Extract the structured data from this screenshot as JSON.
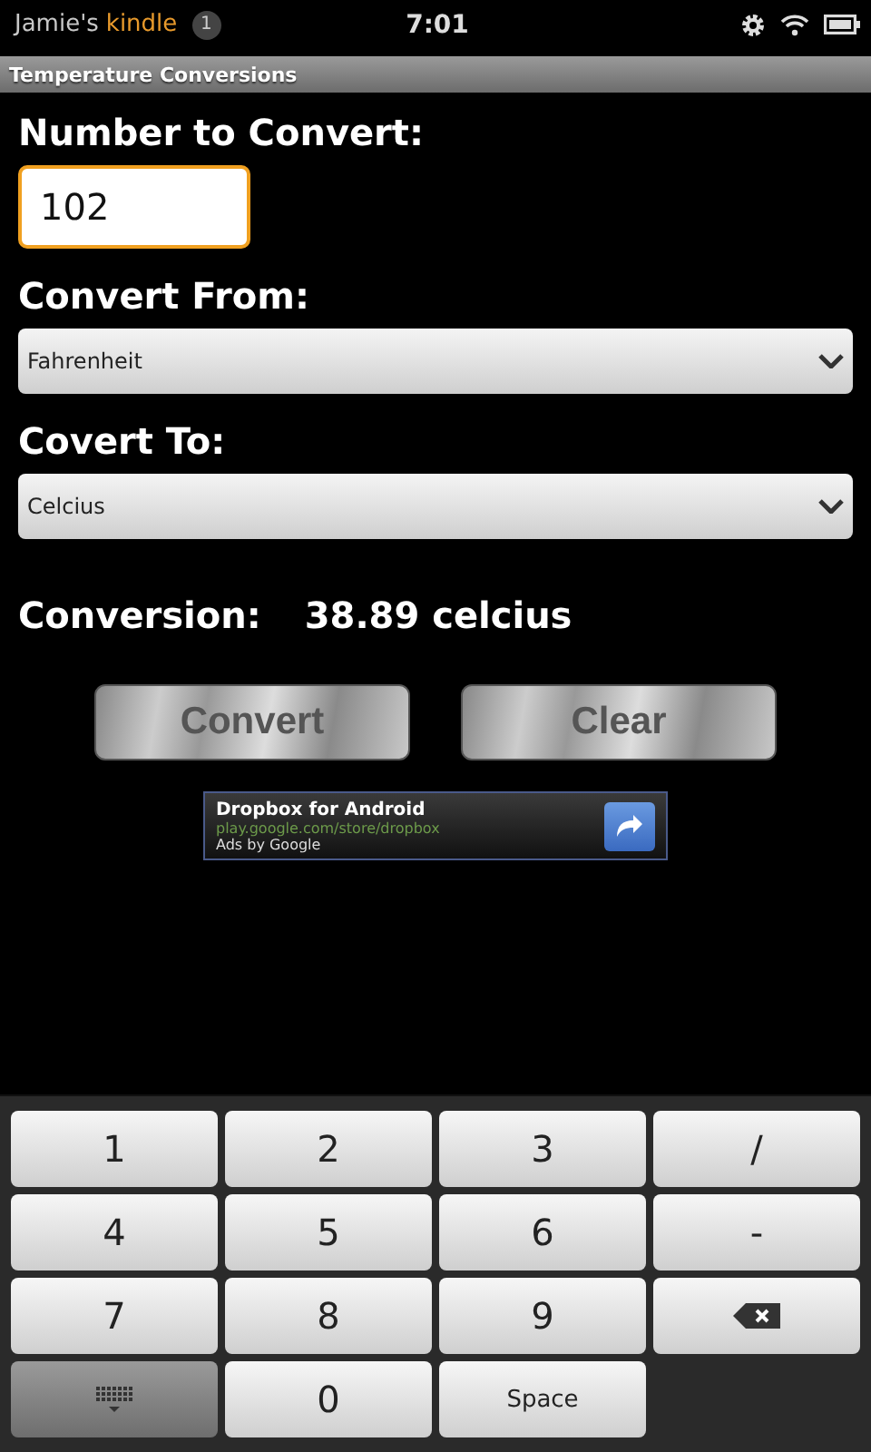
{
  "status_bar": {
    "owner": "Jamie's",
    "brand": "kindle",
    "notification_count": "1",
    "time": "7:01"
  },
  "title_bar": {
    "title": "Temperature Conversions"
  },
  "form": {
    "number_label": "Number to Convert:",
    "number_value": "102",
    "from_label": "Convert From:",
    "from_value": "Fahrenheit",
    "to_label": "Covert To:",
    "to_value": "Celcius",
    "conversion_label": "Conversion:",
    "conversion_value": "38.89 celcius"
  },
  "buttons": [
    "Convert",
    "Clear"
  ],
  "ad": {
    "title": "Dropbox for Android",
    "url": "play.google.com/store/dropbox",
    "attribution": "Ads by Google"
  },
  "keyboard": [
    {
      "kind": "text",
      "label": "1"
    },
    {
      "kind": "text",
      "label": "2"
    },
    {
      "kind": "text",
      "label": "3"
    },
    {
      "kind": "text",
      "label": "/"
    },
    {
      "kind": "text",
      "label": "4"
    },
    {
      "kind": "text",
      "label": "5"
    },
    {
      "kind": "text",
      "label": "6"
    },
    {
      "kind": "text",
      "label": "-"
    },
    {
      "kind": "text",
      "label": "7"
    },
    {
      "kind": "text",
      "label": "8"
    },
    {
      "kind": "text",
      "label": "9"
    },
    {
      "kind": "backspace"
    },
    {
      "kind": "hide"
    },
    {
      "kind": "text",
      "label": "0"
    },
    {
      "kind": "space",
      "label": "Space"
    }
  ]
}
